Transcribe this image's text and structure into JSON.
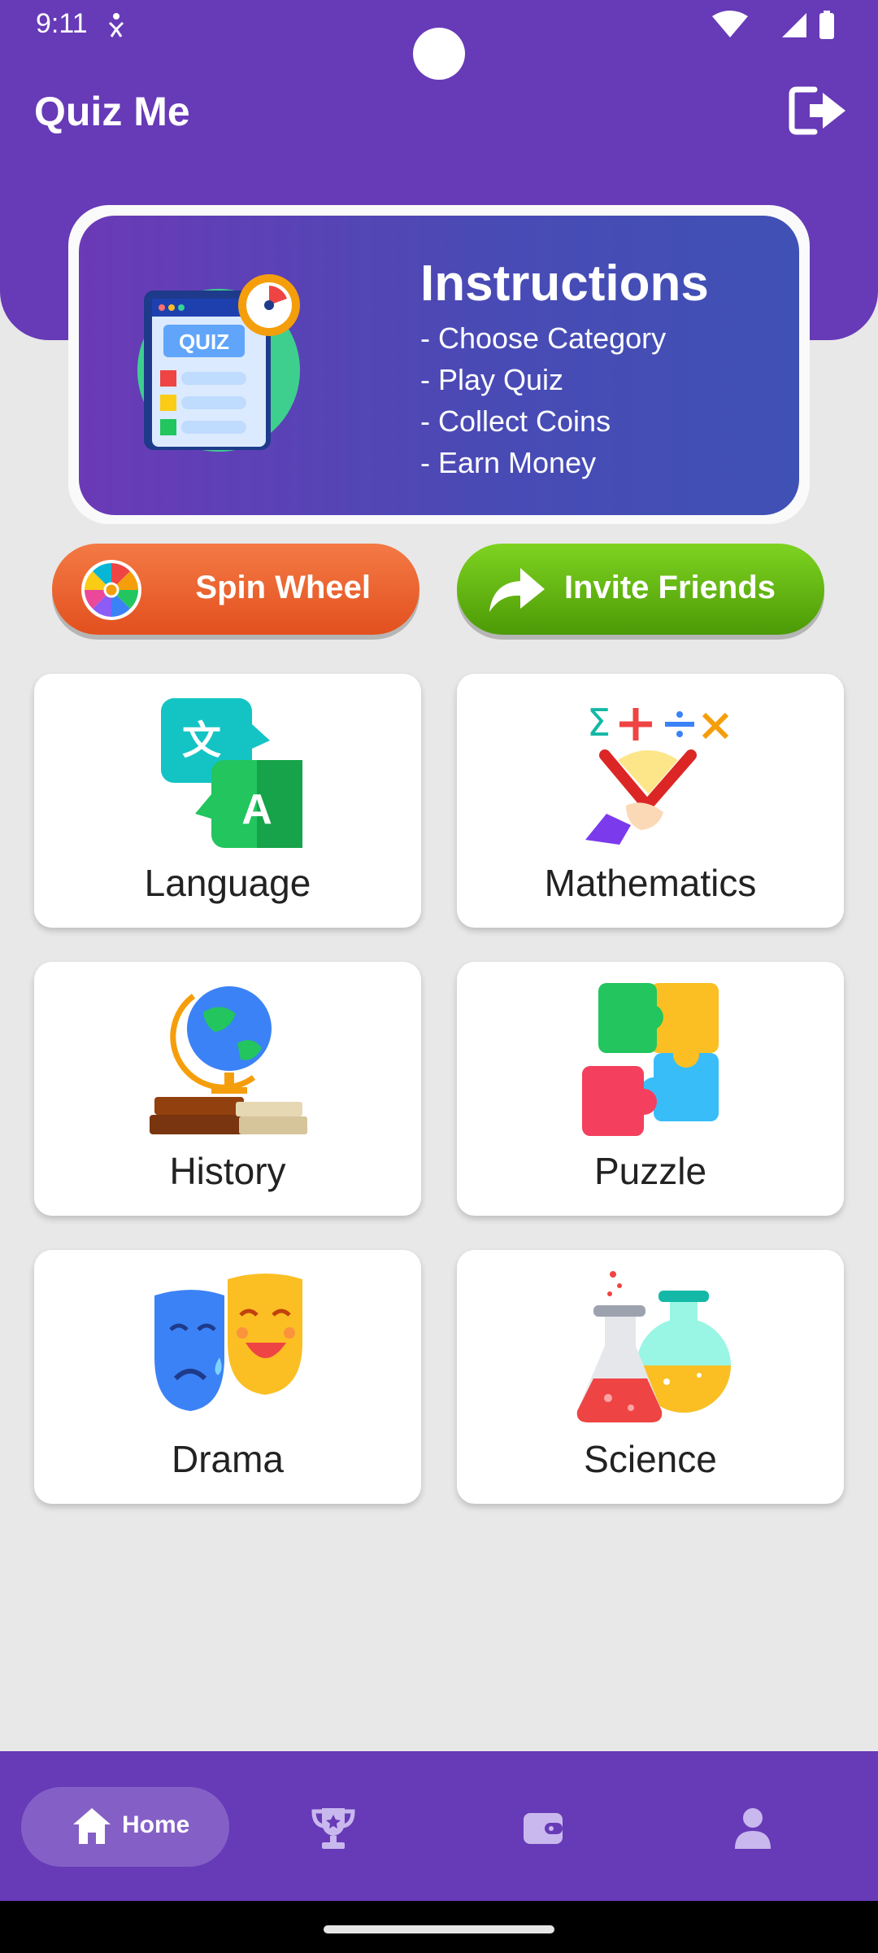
{
  "status": {
    "time": "9:11"
  },
  "header": {
    "title": "Quiz Me"
  },
  "instructions": {
    "title": "Instructions",
    "badge": "QUIZ",
    "lines": [
      "- Choose Category",
      "- Play Quiz",
      "- Collect Coins",
      "- Earn Money"
    ]
  },
  "actions": {
    "spin_label": "Spin Wheel",
    "invite_label": "Invite Friends"
  },
  "categories": [
    "Language",
    "Mathematics",
    "History",
    "Puzzle",
    "Drama",
    "Science"
  ],
  "nav": {
    "home_label": "Home"
  },
  "colors": {
    "primary": "#673ab7",
    "spin": "#e9602a",
    "invite": "#5fb012",
    "background": "#e8e8e8"
  },
  "icons": {
    "logout": "logout-icon",
    "spin": "spin-wheel-icon",
    "invite": "share-arrow-icon",
    "nav": [
      "home-icon",
      "trophy-icon",
      "wallet-icon",
      "profile-icon"
    ]
  }
}
